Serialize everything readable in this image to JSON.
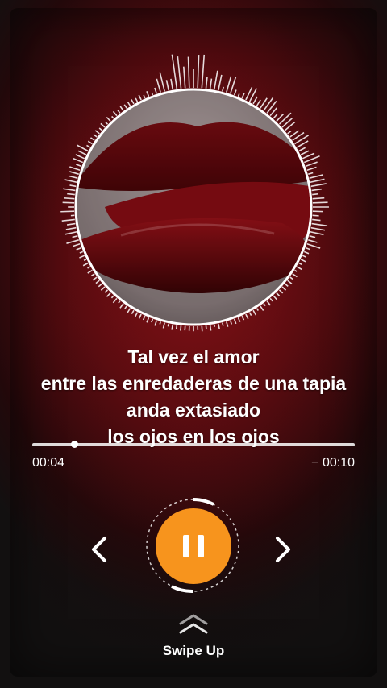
{
  "player": {
    "cover_icon": "lips-cover-art",
    "lyrics": [
      "Tal vez el amor",
      "entre las enredaderas de una tapia",
      "anda extasiado",
      "los ojos en los ojos"
    ],
    "elapsed": "00:04",
    "remaining": "− 00:10",
    "progress_fraction": 0.13,
    "state": "playing",
    "colors": {
      "accent": "#f7941d",
      "background": "#6e0d12",
      "text": "#ffffff"
    }
  },
  "controls": {
    "prev_icon": "chevron-left-icon",
    "pause_icon": "pause-icon",
    "next_icon": "chevron-right-icon"
  },
  "swipe": {
    "label": "Swipe Up",
    "icon": "double-chevron-up-icon"
  }
}
